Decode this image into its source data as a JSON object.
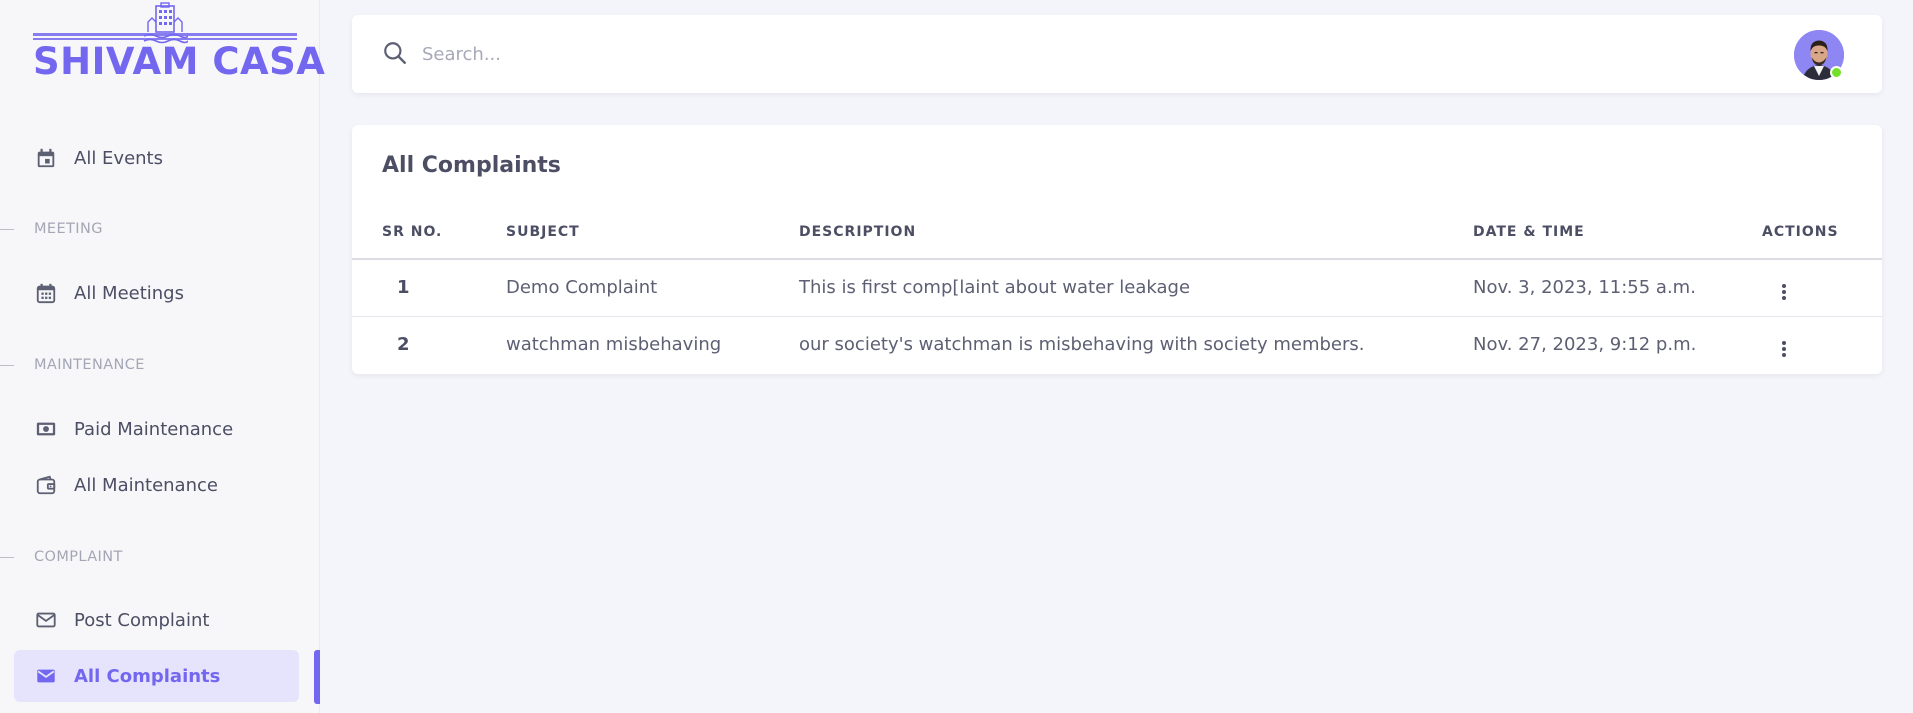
{
  "brand": {
    "name": "SHIVAM CASA",
    "color": "#7367f0"
  },
  "sidebar": {
    "items": [
      {
        "label": "All Events",
        "icon": "calendar-icon"
      },
      {
        "section": "MEETING"
      },
      {
        "label": "All Meetings",
        "icon": "calendar-grid-icon"
      },
      {
        "section": "MAINTENANCE"
      },
      {
        "label": "Paid Maintenance",
        "icon": "cash-icon"
      },
      {
        "label": "All Maintenance",
        "icon": "wallet-icon"
      },
      {
        "section": "COMPLAINT"
      },
      {
        "label": "Post Complaint",
        "icon": "mail-outline-icon"
      },
      {
        "label": "All Complaints",
        "icon": "mail-filled-icon",
        "active": true
      }
    ]
  },
  "header": {
    "search_placeholder": "Search...",
    "search_value": "",
    "avatar_status": "online",
    "status_color": "#72e128"
  },
  "main": {
    "title": "All Complaints",
    "columns": [
      "SR NO.",
      "SUBJECT",
      "DESCRIPTION",
      "DATE & TIME",
      "ACTIONS"
    ],
    "rows": [
      {
        "sr": "1",
        "subject": "Demo Complaint",
        "description": "This is first comp[laint about water leakage",
        "datetime": "Nov. 3, 2023, 11:55 a.m.",
        "action_icon": "more-vertical-icon"
      },
      {
        "sr": "2",
        "subject": "watchman misbehaving",
        "description": "our society's watchman is misbehaving with society members.",
        "datetime": "Nov. 27, 2023, 9:12 p.m.",
        "action_icon": "more-vertical-icon"
      }
    ]
  }
}
